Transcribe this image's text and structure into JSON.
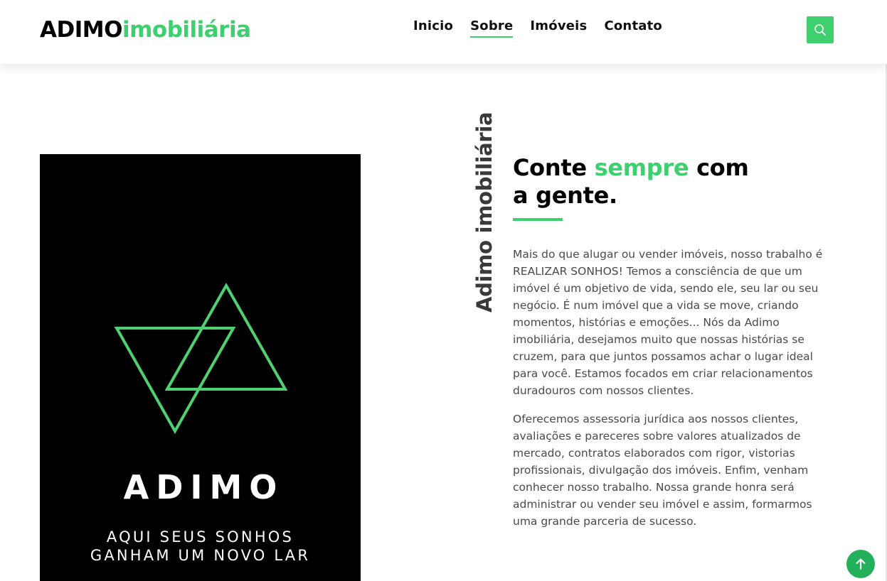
{
  "header": {
    "logo_dark": "ADIMO",
    "logo_green": "imobiliária",
    "nav": [
      "Inicio",
      "Sobre",
      "Imóveis",
      "Contato"
    ],
    "active_nav": "Sobre",
    "search_icon": "search-icon"
  },
  "promo": {
    "title": "ADIMO",
    "line1": "AQUI SEUS SONHOS",
    "line2": "GANHAM UM NOVO LAR",
    "mark_icon": "triangles-logo-icon"
  },
  "about": {
    "vertical_label": "Adimo imobiliária",
    "headline_part1": "Conte ",
    "headline_highlight": "sempre",
    "headline_part2": " com",
    "headline_line2": "a gente.",
    "paragraph1": "Mais do que alugar ou vender imóveis, nosso trabalho é REALIZAR SONHOS! Temos a consciência de que um imóvel é um objetivo de vida, sendo ele, seu lar ou seu negócio. É num imóvel que a vida se move, criando momentos, histórias e emoções... Nós da Adimo imobiliária, desejamos muito que nossas histórias se cruzem, para que juntos possamos achar o lugar ideal para você. Estamos focados em criar relacionamentos duradouros com nossos clientes.",
    "paragraph2": "Oferecemos assessoria jurídica aos nossos clientes, avaliações e pareceres sobre valores atualizados de mercado, contratos elaborados com rigor, vistorias profissionais, divulgação dos imóveis. Enfim, venham conhecer nosso trabalho. Nossa grande honra será administrar ou vender seu imóvel e assim, formarmos uma grande parceria de sucesso."
  },
  "back_to_top_icon": "arrow-up-icon",
  "colors": {
    "accent": "#3ecf6e",
    "button_dark_green": "#22b05a",
    "promo_bg": "#000000"
  }
}
